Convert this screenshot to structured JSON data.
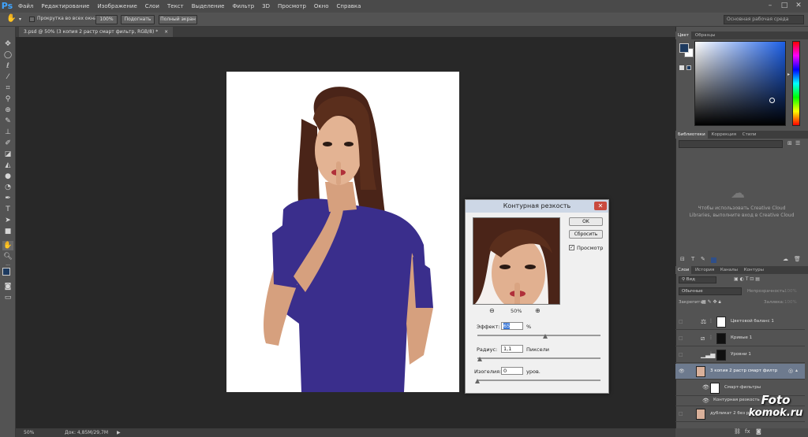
{
  "menubar": {
    "logo": "Ps",
    "items": [
      "Файл",
      "Редактирование",
      "Изображение",
      "Слои",
      "Текст",
      "Выделение",
      "Фильтр",
      "3D",
      "Просмотр",
      "Окно",
      "Справка"
    ],
    "controls": [
      "–",
      "□",
      "✕"
    ]
  },
  "options": {
    "scroll_all": "Прокрутка во всех окнах",
    "zoom100": "100%",
    "fit": "Подогнать",
    "fullscreen": "Полный экран",
    "workspace": "Основная рабочая среда"
  },
  "document": {
    "tab_title": "3.psd @ 50% (3 копия 2 растр смарт фильтр, RGB/8) *",
    "close": "×"
  },
  "status": {
    "zoom": "50%",
    "doc_size": "Док: 4,85M/29,7M"
  },
  "dialog": {
    "title": "Контурная резкость",
    "close": "✕",
    "ok": "OK",
    "reset": "Сбросить",
    "preview_label": "Просмотр",
    "preview_checked": true,
    "zoom": "50%",
    "effect_label": "Эффект:",
    "effect_value": "65",
    "effect_unit": "%",
    "effect_level": 0.55,
    "radius_label": "Радиус:",
    "radius_value": "1,1",
    "radius_unit": "Пиксели",
    "radius_level": 0.02,
    "threshold_label": "Изогелия:",
    "threshold_value": "0",
    "threshold_unit": "уров.",
    "threshold_level": 0.0
  },
  "color_panel": {
    "tabs": [
      "Цвет",
      "Образцы"
    ],
    "fg_color": "#1d3a5f",
    "bg_color": "#ffffff"
  },
  "libraries_panel": {
    "tabs": [
      "Библиотеки",
      "Коррекция",
      "Стили"
    ],
    "message": "Чтобы использовать Creative Cloud Libraries, выполните вход в Creative Cloud"
  },
  "layers_panel": {
    "tabs": [
      "Слои",
      "История",
      "Каналы",
      "Контуры"
    ],
    "filter_kind": "Вид",
    "blend_mode": "Обычные",
    "opacity_label": "Непрозрачность:",
    "opacity_value": "100%",
    "lock_label": "Закрепить:",
    "fill_label": "Заливка:",
    "fill_value": "100%",
    "layers": [
      {
        "name": "Цветовой баланс 1"
      },
      {
        "name": "Кривые 1"
      },
      {
        "name": "Уровни 1"
      },
      {
        "name": "3 копия 2 растр смарт филтр"
      },
      {
        "name": "Смарт-фильтры"
      },
      {
        "name": "Контурная резкость"
      },
      {
        "name": "дубликат 2 без растрирования"
      }
    ]
  },
  "watermark": {
    "line1": "Foto",
    "line2": "komok.ru"
  }
}
